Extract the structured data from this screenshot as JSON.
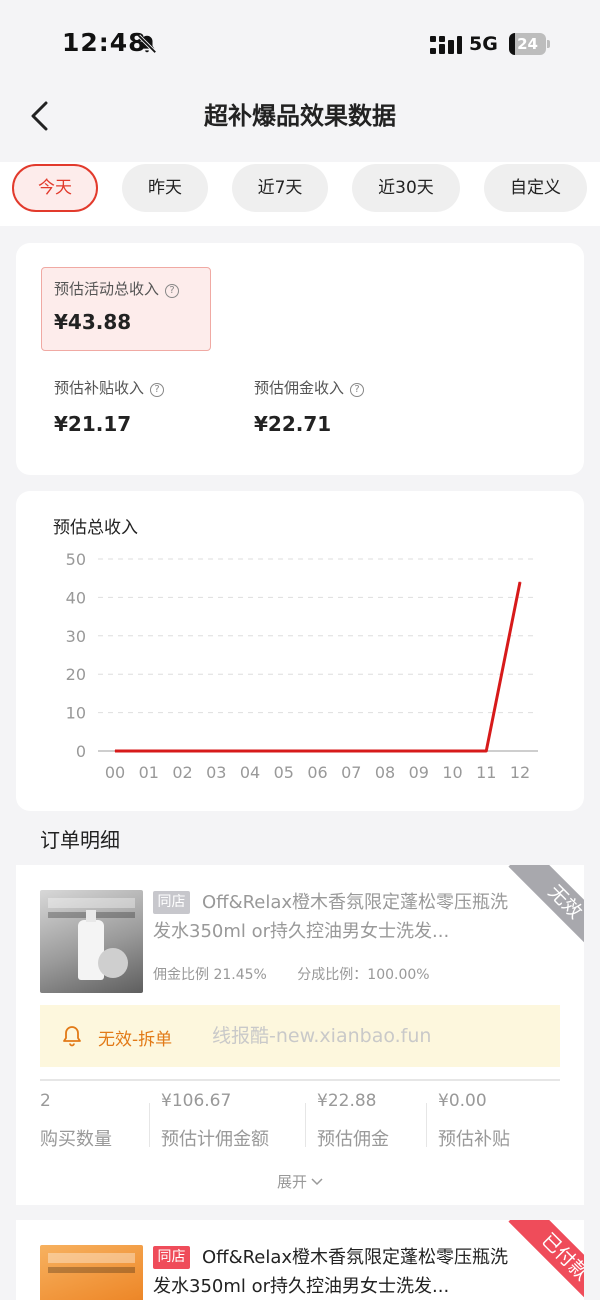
{
  "status_bar": {
    "time": "12:48",
    "network": "5G",
    "battery": "24"
  },
  "header": {
    "title": "超补爆品效果数据"
  },
  "tabs": [
    {
      "label": "今天",
      "active": true
    },
    {
      "label": "昨天",
      "active": false
    },
    {
      "label": "近7天",
      "active": false
    },
    {
      "label": "近30天",
      "active": false
    },
    {
      "label": "自定义",
      "active": false
    }
  ],
  "summary": {
    "total_label": "预估活动总收入",
    "total_value": "¥43.88",
    "subsidy_label": "预估补贴收入",
    "subsidy_value": "¥21.17",
    "commission_label": "预估佣金收入",
    "commission_value": "¥22.71"
  },
  "chart": {
    "title": "预估总收入"
  },
  "chart_data": {
    "type": "line",
    "title": "预估总收入",
    "x": [
      "00",
      "01",
      "02",
      "03",
      "04",
      "05",
      "06",
      "07",
      "08",
      "09",
      "10",
      "11",
      "12"
    ],
    "series": [
      {
        "values": [
          0,
          0,
          0,
          0,
          0,
          0,
          0,
          0,
          0,
          0,
          0,
          0,
          44
        ]
      }
    ],
    "yticks": [
      0,
      10,
      20,
      30,
      40,
      50
    ],
    "ylim": [
      0,
      50
    ],
    "grid": true,
    "color": "#d71a1a"
  },
  "orders": {
    "section_title": "订单明细",
    "items": [
      {
        "shop_tag": "同店",
        "title": "Off&Relax橙木香氛限定蓬松零压瓶洗发水350ml or持久控油男女士洗发...",
        "commission_ratio": "佣金比例 21.45%",
        "share_ratio": "分成比例：100.00%",
        "status_ribbon": "无效",
        "notice": "无效-拆单",
        "watermark": "线报酷-new.xianbao.fun",
        "stats": [
          {
            "value": "2",
            "label": "购买数量"
          },
          {
            "value": "¥106.67",
            "label": "预估计佣金额"
          },
          {
            "value": "¥22.88",
            "label": "预估佣金"
          },
          {
            "value": "¥0.00",
            "label": "预估补贴"
          }
        ],
        "expand_label": "展开"
      },
      {
        "shop_tag": "同店",
        "title": "Off&Relax橙木香氛限定蓬松零压瓶洗发水350ml or持久控油男女士洗发...",
        "status_ribbon": "已付款"
      }
    ]
  }
}
